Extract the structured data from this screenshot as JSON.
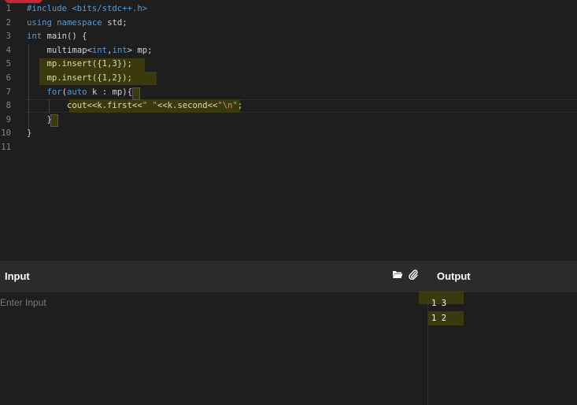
{
  "editor": {
    "lines": [
      {
        "num": "1",
        "segments": [
          {
            "t": "#include ",
            "c": "kw"
          },
          {
            "t": "<bits/stdc++.h>",
            "c": "kw"
          }
        ]
      },
      {
        "num": "2",
        "segments": [
          {
            "t": "using ",
            "c": "kw"
          },
          {
            "t": "namespace ",
            "c": "kw"
          },
          {
            "t": "std;",
            "c": ""
          }
        ]
      },
      {
        "num": "3",
        "segments": [
          {
            "t": "int ",
            "c": "kw"
          },
          {
            "t": "main() {",
            "c": ""
          }
        ]
      },
      {
        "num": "4",
        "segments": [
          {
            "t": "    multimap<",
            "c": ""
          },
          {
            "t": "int",
            "c": "kw"
          },
          {
            "t": ",",
            "c": ""
          },
          {
            "t": "int",
            "c": "kw"
          },
          {
            "t": "> mp;",
            "c": ""
          }
        ]
      },
      {
        "num": "5",
        "segments": [
          {
            "t": "    mp.insert({1,3});",
            "c": "yl"
          }
        ]
      },
      {
        "num": "6",
        "segments": [
          {
            "t": "    mp.insert({1,2});",
            "c": "yl"
          }
        ]
      },
      {
        "num": "7",
        "segments": [
          {
            "t": "    ",
            "c": ""
          },
          {
            "t": "for",
            "c": "kw"
          },
          {
            "t": "(",
            "c": ""
          },
          {
            "t": "auto ",
            "c": "kw"
          },
          {
            "t": "k : mp){",
            "c": ""
          }
        ]
      },
      {
        "num": "8",
        "segments": [
          {
            "t": "        cout<<k.first<<",
            "c": "yl"
          },
          {
            "t": "\" \"",
            "c": "str"
          },
          {
            "t": "<<k.second<<",
            "c": "yl"
          },
          {
            "t": "\"\\n\"",
            "c": "str"
          },
          {
            "t": ";",
            "c": ""
          }
        ]
      },
      {
        "num": "9",
        "segments": [
          {
            "t": "    }",
            "c": ""
          }
        ]
      },
      {
        "num": "10",
        "segments": [
          {
            "t": "}",
            "c": ""
          }
        ]
      },
      {
        "num": "11",
        "segments": []
      }
    ]
  },
  "input_panel": {
    "title": "Input",
    "placeholder": "Enter Input",
    "open_icon": "folder-open-icon",
    "attach_icon": "paperclip-icon"
  },
  "output_panel": {
    "title": "Output",
    "lines": [
      "1 3",
      "1 2"
    ]
  },
  "colors": {
    "background": "#1e1e1e",
    "panel_header": "#2b2b2b",
    "highlight": "#3a3a0e",
    "keyword": "#569cd6",
    "string": "#ce9178",
    "highlighted_text": "#dcdcaa"
  }
}
